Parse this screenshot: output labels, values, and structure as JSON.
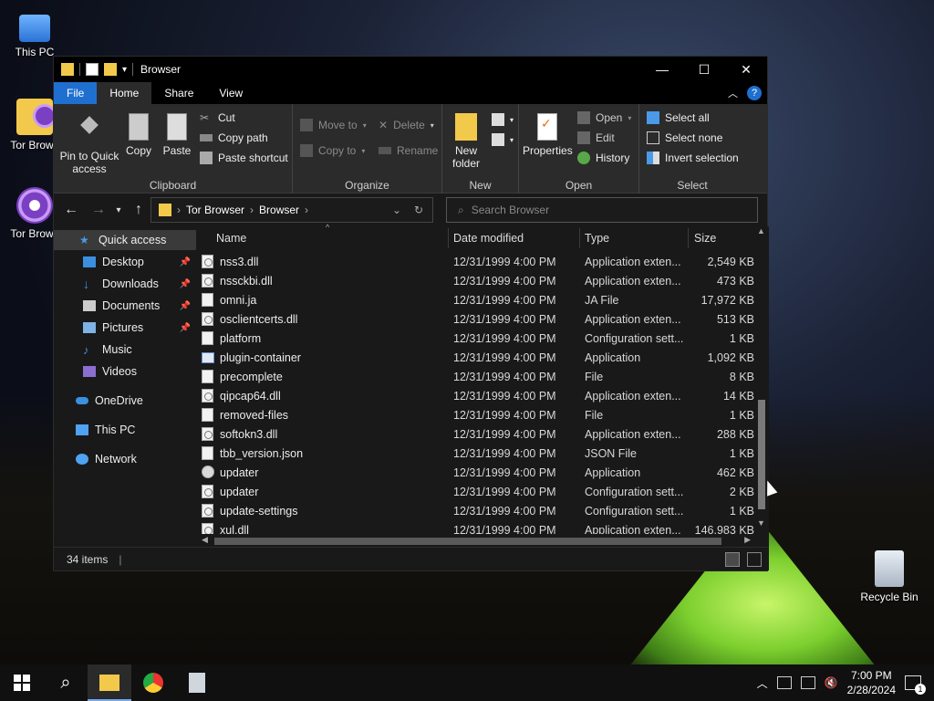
{
  "desktop": {
    "icons": [
      {
        "label": "This PC"
      },
      {
        "label": "Tor Brows"
      },
      {
        "label": "Tor Brows"
      },
      {
        "label": "Recycle Bin"
      }
    ]
  },
  "window": {
    "title": "Browser",
    "controls": {
      "minimize": "—",
      "maximize": "☐",
      "close": "✕"
    }
  },
  "tabs": [
    "File",
    "Home",
    "Share",
    "View"
  ],
  "ribbon": {
    "clipboard": {
      "name": "Clipboard",
      "pin": "Pin to Quick access",
      "copy": "Copy",
      "paste": "Paste",
      "cut": "Cut",
      "copy_path": "Copy path",
      "paste_shortcut": "Paste shortcut"
    },
    "organize": {
      "name": "Organize",
      "move_to": "Move to",
      "copy_to": "Copy to",
      "delete": "Delete",
      "rename": "Rename"
    },
    "new": {
      "name": "New",
      "new_folder": "New folder"
    },
    "open": {
      "name": "Open",
      "properties": "Properties",
      "open": "Open",
      "edit": "Edit",
      "history": "History"
    },
    "select": {
      "name": "Select",
      "select_all": "Select all",
      "select_none": "Select none",
      "invert": "Invert selection"
    }
  },
  "address": {
    "crumbs": [
      "Tor Browser",
      "Browser"
    ],
    "search_placeholder": "Search Browser"
  },
  "nav": {
    "quick_access": "Quick access",
    "items": [
      {
        "label": "Desktop",
        "pinned": true
      },
      {
        "label": "Downloads",
        "pinned": true
      },
      {
        "label": "Documents",
        "pinned": true
      },
      {
        "label": "Pictures",
        "pinned": true
      },
      {
        "label": "Music",
        "pinned": false
      },
      {
        "label": "Videos",
        "pinned": false
      }
    ],
    "onedrive": "OneDrive",
    "this_pc": "This PC",
    "network": "Network"
  },
  "columns": {
    "name": "Name",
    "date": "Date modified",
    "type": "Type",
    "size": "Size"
  },
  "files": [
    {
      "name": "nss3.dll",
      "date": "12/31/1999 4:00 PM",
      "type": "Application exten...",
      "size": "2,549 KB",
      "icon": "gear"
    },
    {
      "name": "nssckbi.dll",
      "date": "12/31/1999 4:00 PM",
      "type": "Application exten...",
      "size": "473 KB",
      "icon": "gear"
    },
    {
      "name": "omni.ja",
      "date": "12/31/1999 4:00 PM",
      "type": "JA File",
      "size": "17,972 KB",
      "icon": "file"
    },
    {
      "name": "osclientcerts.dll",
      "date": "12/31/1999 4:00 PM",
      "type": "Application exten...",
      "size": "513 KB",
      "icon": "gear"
    },
    {
      "name": "platform",
      "date": "12/31/1999 4:00 PM",
      "type": "Configuration sett...",
      "size": "1 KB",
      "icon": "file"
    },
    {
      "name": "plugin-container",
      "date": "12/31/1999 4:00 PM",
      "type": "Application",
      "size": "1,092 KB",
      "icon": "app"
    },
    {
      "name": "precomplete",
      "date": "12/31/1999 4:00 PM",
      "type": "File",
      "size": "8 KB",
      "icon": "file"
    },
    {
      "name": "qipcap64.dll",
      "date": "12/31/1999 4:00 PM",
      "type": "Application exten...",
      "size": "14 KB",
      "icon": "gear"
    },
    {
      "name": "removed-files",
      "date": "12/31/1999 4:00 PM",
      "type": "File",
      "size": "1 KB",
      "icon": "file"
    },
    {
      "name": "softokn3.dll",
      "date": "12/31/1999 4:00 PM",
      "type": "Application exten...",
      "size": "288 KB",
      "icon": "gear"
    },
    {
      "name": "tbb_version.json",
      "date": "12/31/1999 4:00 PM",
      "type": "JSON File",
      "size": "1 KB",
      "icon": "file"
    },
    {
      "name": "updater",
      "date": "12/31/1999 4:00 PM",
      "type": "Application",
      "size": "462 KB",
      "icon": "upd"
    },
    {
      "name": "updater",
      "date": "12/31/1999 4:00 PM",
      "type": "Configuration sett...",
      "size": "2 KB",
      "icon": "gear"
    },
    {
      "name": "update-settings",
      "date": "12/31/1999 4:00 PM",
      "type": "Configuration sett...",
      "size": "1 KB",
      "icon": "gear"
    },
    {
      "name": "xul.dll",
      "date": "12/31/1999 4:00 PM",
      "type": "Application exten...",
      "size": "146,983 KB",
      "icon": "gear"
    }
  ],
  "status": {
    "items": "34 items"
  },
  "taskbar": {
    "time": "7:00 PM",
    "date": "2/28/2024",
    "notifications": "1"
  },
  "colors": {
    "accent": "#1f6fd0",
    "folder": "#f3c94b"
  }
}
